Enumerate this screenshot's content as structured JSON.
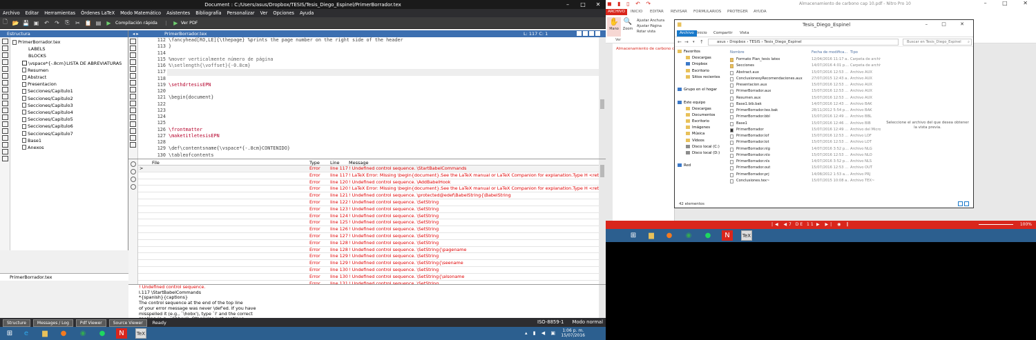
{
  "texmaker": {
    "title": "Document : C:/Users/asus/Dropbox/TESIS/Tesis_Diego_Espinel/PrimerBorrador.tex",
    "window_buttons": [
      "–",
      "□",
      "✕"
    ],
    "menu": [
      "Archivo",
      "Editar",
      "Herramientas",
      "Órdenes LaTeX",
      "Modo Matemático",
      "Asistentes",
      "Bibliografía",
      "Personalizar",
      "Ver",
      "Opciones",
      "Ayuda"
    ],
    "toolbar": {
      "compile_label": "Compilación rápida",
      "view_label": "Ver PDF"
    },
    "structure": {
      "header": "Estructura",
      "items": [
        {
          "label": "PrimerBorrador.tex",
          "level": 0,
          "kind": "file"
        },
        {
          "label": "LABELS",
          "level": 1,
          "kind": "plain"
        },
        {
          "label": "BLOCKS",
          "level": 1,
          "kind": "plain"
        },
        {
          "label": "\\vspace*{-.8cm}LISTA DE ABREVIATURAS",
          "level": 1,
          "kind": "section"
        },
        {
          "label": "Resumen",
          "level": 1,
          "kind": "file"
        },
        {
          "label": "Abstract",
          "level": 1,
          "kind": "file"
        },
        {
          "label": "Presentacion",
          "level": 1,
          "kind": "file"
        },
        {
          "label": "Secciones/Capitulo1",
          "level": 1,
          "kind": "file"
        },
        {
          "label": "Secciones/Capitulo2",
          "level": 1,
          "kind": "file"
        },
        {
          "label": "Secciones/Capitulo3",
          "level": 1,
          "kind": "file"
        },
        {
          "label": "Secciones/Capitulo4",
          "level": 1,
          "kind": "file"
        },
        {
          "label": "Secciones/Capitulo5",
          "level": 1,
          "kind": "file"
        },
        {
          "label": "Secciones/Capitulo6",
          "level": 1,
          "kind": "file"
        },
        {
          "label": "Secciones/Capitulo7",
          "level": 1,
          "kind": "file"
        },
        {
          "label": "Base1",
          "level": 1,
          "kind": "file"
        },
        {
          "label": "Anexos",
          "level": 1,
          "kind": "file"
        }
      ],
      "bottom_tab": "PrimerBorrador.tex"
    },
    "editor": {
      "tab_name": "PrimerBorrador.tex",
      "cursor_pos": "L: 117 C: 1",
      "lines": [
        {
          "n": "112",
          "text": "\\fancyhead[RO,LE]{\\thepage} %prints the page number on the right side of the header",
          "style": "cmd"
        },
        {
          "n": "113",
          "text": "}",
          "style": "plain"
        },
        {
          "n": "114",
          "text": "",
          "style": "plain"
        },
        {
          "n": "115",
          "text": "%mover verticalmente número de página",
          "style": "comment"
        },
        {
          "n": "116",
          "text": "%\\setlength{\\voffset}{-0.8cm}",
          "style": "comment"
        },
        {
          "n": "117",
          "text": "",
          "style": "current"
        },
        {
          "n": "118",
          "text": "",
          "style": "plain"
        },
        {
          "n": "119",
          "text": "\\sethdrtesisEPN",
          "style": "kw"
        },
        {
          "n": "120",
          "text": "",
          "style": "plain"
        },
        {
          "n": "121",
          "text": "\\begin{document}",
          "style": "cmd"
        },
        {
          "n": "122",
          "text": "",
          "style": "plain"
        },
        {
          "n": "123",
          "text": "",
          "style": "plain"
        },
        {
          "n": "124",
          "text": "",
          "style": "plain"
        },
        {
          "n": "125",
          "text": "",
          "style": "plain"
        },
        {
          "n": "126",
          "text": "\\frontmatter",
          "style": "kw"
        },
        {
          "n": "127",
          "text": "\\maketitletesisEPN",
          "style": "kw"
        },
        {
          "n": "128",
          "text": "",
          "style": "plain"
        },
        {
          "n": "129",
          "text": "\\def\\contentsname{\\vspace*{-.8cm}CONTENIDO}",
          "style": "cmd"
        },
        {
          "n": "130",
          "text": "\\tableofcontents",
          "style": "cmd"
        }
      ]
    },
    "errors": {
      "headers": {
        "file": "File",
        "type": "Type",
        "line": "Line",
        "message": "Message"
      },
      "rows": [
        {
          "marker": ">",
          "type": "Error",
          "line": "line 117",
          "message": "! Undefined control sequence. \\StartBabelCommands"
        },
        {
          "marker": "",
          "type": "Error",
          "line": "line 117",
          "message": "! LaTeX Error: Missing \\begin{document}.See the LaTeX manual or LaTeX Companion for explanation.Type H <return> ..."
        },
        {
          "marker": "",
          "type": "Error",
          "line": "line 120",
          "message": "! Undefined control sequence. \\AddBabelHook"
        },
        {
          "marker": "",
          "type": "Error",
          "line": "line 120",
          "message": "! LaTeX Error: Missing \\begin{document}.See the LaTeX manual or LaTeX Companion for explanation.Type H <return> ..."
        },
        {
          "marker": "",
          "type": "Error",
          "line": "line 121",
          "message": "! Undefined control sequence. \\protected@edef\\BabelString{\\BabelString"
        },
        {
          "marker": "",
          "type": "Error",
          "line": "line 122",
          "message": "! Undefined control sequence. \\SetString"
        },
        {
          "marker": "",
          "type": "Error",
          "line": "line 123",
          "message": "! Undefined control sequence. \\SetString"
        },
        {
          "marker": "",
          "type": "Error",
          "line": "line 124",
          "message": "! Undefined control sequence. \\SetString"
        },
        {
          "marker": "",
          "type": "Error",
          "line": "line 125",
          "message": "! Undefined control sequence. \\SetString"
        },
        {
          "marker": "",
          "type": "Error",
          "line": "line 126",
          "message": "! Undefined control sequence. \\SetString"
        },
        {
          "marker": "",
          "type": "Error",
          "line": "line 127",
          "message": "! Undefined control sequence. \\SetString"
        },
        {
          "marker": "",
          "type": "Error",
          "line": "line 128",
          "message": "! Undefined control sequence. \\SetString"
        },
        {
          "marker": "",
          "type": "Error",
          "line": "line 128",
          "message": "! Undefined control sequence. \\SetString{\\pagename"
        },
        {
          "marker": "",
          "type": "Error",
          "line": "line 129",
          "message": "! Undefined control sequence. \\SetString"
        },
        {
          "marker": "",
          "type": "Error",
          "line": "line 129",
          "message": "! Undefined control sequence. \\SetString{\\seename"
        },
        {
          "marker": "",
          "type": "Error",
          "line": "line 130",
          "message": "! Undefined control sequence. \\SetString"
        },
        {
          "marker": "",
          "type": "Error",
          "line": "line 130",
          "message": "! Undefined control sequence. \\SetString{\\alsoname"
        },
        {
          "marker": "",
          "type": "Error",
          "line": "line 131",
          "message": "! Undefined control sequence. \\SetString"
        }
      ]
    },
    "log": [
      {
        "text": "! Undefined control sequence.",
        "red": true
      },
      {
        "text": "l.117 \\StartBabelCommands",
        "red": false
      },
      {
        "text": "*{spanish}{captions}",
        "red": false
      },
      {
        "text": "The control sequence at the end of the top line",
        "red": false
      },
      {
        "text": "of your error message was never \\def'ed. If you have",
        "red": false
      },
      {
        "text": "misspelled it (e.g., `\\hobx'), type `I' and the correct",
        "red": false
      },
      {
        "text": "spelling (e.g., `I\\hbox'). Otherwise just continue,",
        "red": false
      }
    ],
    "status": {
      "buttons": [
        "Structure",
        "Messages / Log",
        "Pdf Viewer",
        "Source Viewer"
      ],
      "ready": "Ready",
      "encoding": "ISO-8859-1",
      "mode": "Modo normal"
    },
    "clock": {
      "time": "1:06 p. m.",
      "date": "15/07/2016"
    }
  },
  "nitro": {
    "title": "Almacenamiento de carbono cap 10.pdf - Nitro Pro 10",
    "tabs": [
      "ARCHIVO",
      "INICIO",
      "EDITAR",
      "REVISAR",
      "FORMULARIOS",
      "PROTEGER",
      "AYUDA"
    ],
    "ribbon": {
      "hand": "Mano",
      "zoom": "Zoom",
      "ver": "Ver",
      "fit_width": "Ajustar Anchura",
      "fit_page": "Ajustar Página",
      "rotate": "Rotar vista"
    },
    "bookmark": "Almacenamiento de carbono cap",
    "page_indicator": "7 DE 11",
    "zoom": "100%"
  },
  "explorer": {
    "title": "Tesis_Diego_Espinel",
    "tabs": [
      "Archivo",
      "Inicio",
      "Compartir",
      "Vista"
    ],
    "breadcrumb": "asus  ›  Dropbox  ›  TESIS  ›  Tesis_Diego_Espinel",
    "search_placeholder": "Buscar en Tesis_Diego_Espinel",
    "nav": [
      {
        "label": "Favoritos",
        "indent": 0,
        "icon": "star"
      },
      {
        "label": "Descargas",
        "indent": 1,
        "icon": "folder"
      },
      {
        "label": "Dropbox",
        "indent": 1,
        "icon": "dropbox"
      },
      {
        "label": "Escritorio",
        "indent": 1,
        "icon": "folder"
      },
      {
        "label": "Sitios recientes",
        "indent": 1,
        "icon": "folder"
      },
      {
        "label": "",
        "indent": 0,
        "icon": "none"
      },
      {
        "label": "Grupo en el hogar",
        "indent": 0,
        "icon": "homegroup"
      },
      {
        "label": "",
        "indent": 0,
        "icon": "none"
      },
      {
        "label": "Este equipo",
        "indent": 0,
        "icon": "pc"
      },
      {
        "label": "Descargas",
        "indent": 1,
        "icon": "folder"
      },
      {
        "label": "Documentos",
        "indent": 1,
        "icon": "folder"
      },
      {
        "label": "Escritorio",
        "indent": 1,
        "icon": "folder"
      },
      {
        "label": "Imágenes",
        "indent": 1,
        "icon": "folder"
      },
      {
        "label": "Música",
        "indent": 1,
        "icon": "folder"
      },
      {
        "label": "Vídeos",
        "indent": 1,
        "icon": "folder"
      },
      {
        "label": "Disco local (C:)",
        "indent": 1,
        "icon": "drive"
      },
      {
        "label": "Disco local (D:)",
        "indent": 1,
        "icon": "drive"
      },
      {
        "label": "",
        "indent": 0,
        "icon": "none"
      },
      {
        "label": "Red",
        "indent": 0,
        "icon": "network"
      }
    ],
    "columns": {
      "name": "Nombre",
      "date": "Fecha de modifica...",
      "type": "Tipo"
    },
    "files": [
      {
        "name": "Formato Plan_tesis latex",
        "date": "12/04/2016 11:17 a....",
        "type": "Carpeta de archivos",
        "icon": "folder"
      },
      {
        "name": "Secciones",
        "date": "14/07/2016 4:01 p....",
        "type": "Carpeta de archivos",
        "icon": "folder"
      },
      {
        "name": "Abstract.aux",
        "date": "15/07/2016 12:53 ...",
        "type": "Archivo AUX",
        "icon": "file"
      },
      {
        "name": "ConclusionesyRecomendaciones.aux",
        "date": "27/07/2015 12:43 a....",
        "type": "Archivo AUX",
        "icon": "file"
      },
      {
        "name": "Presentacion.aux",
        "date": "15/07/2016 12:53 ...",
        "type": "Archivo AUX",
        "icon": "file"
      },
      {
        "name": "PrimerBorrador.aux",
        "date": "15/07/2016 12:53 ...",
        "type": "Archivo AUX",
        "icon": "file"
      },
      {
        "name": "Resumen.aux",
        "date": "15/07/2016 12:53 ...",
        "type": "Archivo AUX",
        "icon": "file"
      },
      {
        "name": "Base1.bib.bak",
        "date": "14/07/2016 12:43 ...",
        "type": "Archivo BAK",
        "icon": "file"
      },
      {
        "name": "PrimerBorrador.tex.bak",
        "date": "28/11/2012 5:54 p....",
        "type": "Archivo BAK",
        "icon": "file"
      },
      {
        "name": "PrimerBorrador.bbl",
        "date": "15/07/2016 12:49 ...",
        "type": "Archivo BBL",
        "icon": "file"
      },
      {
        "name": "Base1",
        "date": "15/07/2016 12:46 ...",
        "type": "Archivo BIB",
        "icon": "file"
      },
      {
        "name": "PrimerBorrador",
        "date": "15/07/2016 12:49 ...",
        "type": "Archivo del Micros...",
        "icon": "dark"
      },
      {
        "name": "PrimerBorrador.lof",
        "date": "15/07/2016 12:53 ...",
        "type": "Archivo LOF",
        "icon": "file"
      },
      {
        "name": "PrimerBorrador.lot",
        "date": "15/07/2016 12:53 ...",
        "type": "Archivo LOT",
        "icon": "file"
      },
      {
        "name": "PrimerBorrador.nlg",
        "date": "14/07/2016 3:52 p....",
        "type": "Archivo NLG",
        "icon": "file"
      },
      {
        "name": "PrimerBorrador.nlo",
        "date": "15/07/2016 12:53 ...",
        "type": "Archivo NLO",
        "icon": "file"
      },
      {
        "name": "PrimerBorrador.nls",
        "date": "14/07/2016 3:52 p....",
        "type": "Archivo NLS",
        "icon": "file"
      },
      {
        "name": "PrimerBorrador.out",
        "date": "15/07/2016 12:53 ...",
        "type": "Archivo OUT",
        "icon": "file"
      },
      {
        "name": "PrimerBorrador.prj",
        "date": "14/08/2012 1:53 a....",
        "type": "Archivo PRJ",
        "icon": "file"
      },
      {
        "name": "Conclusiones.tex~",
        "date": "15/07/2015 10:08 a....",
        "type": "Archivo TEX~",
        "icon": "file"
      }
    ],
    "preview_text": "Seleccione el archivo del que desea obtener la vista previa.",
    "status": "42 elementos"
  }
}
